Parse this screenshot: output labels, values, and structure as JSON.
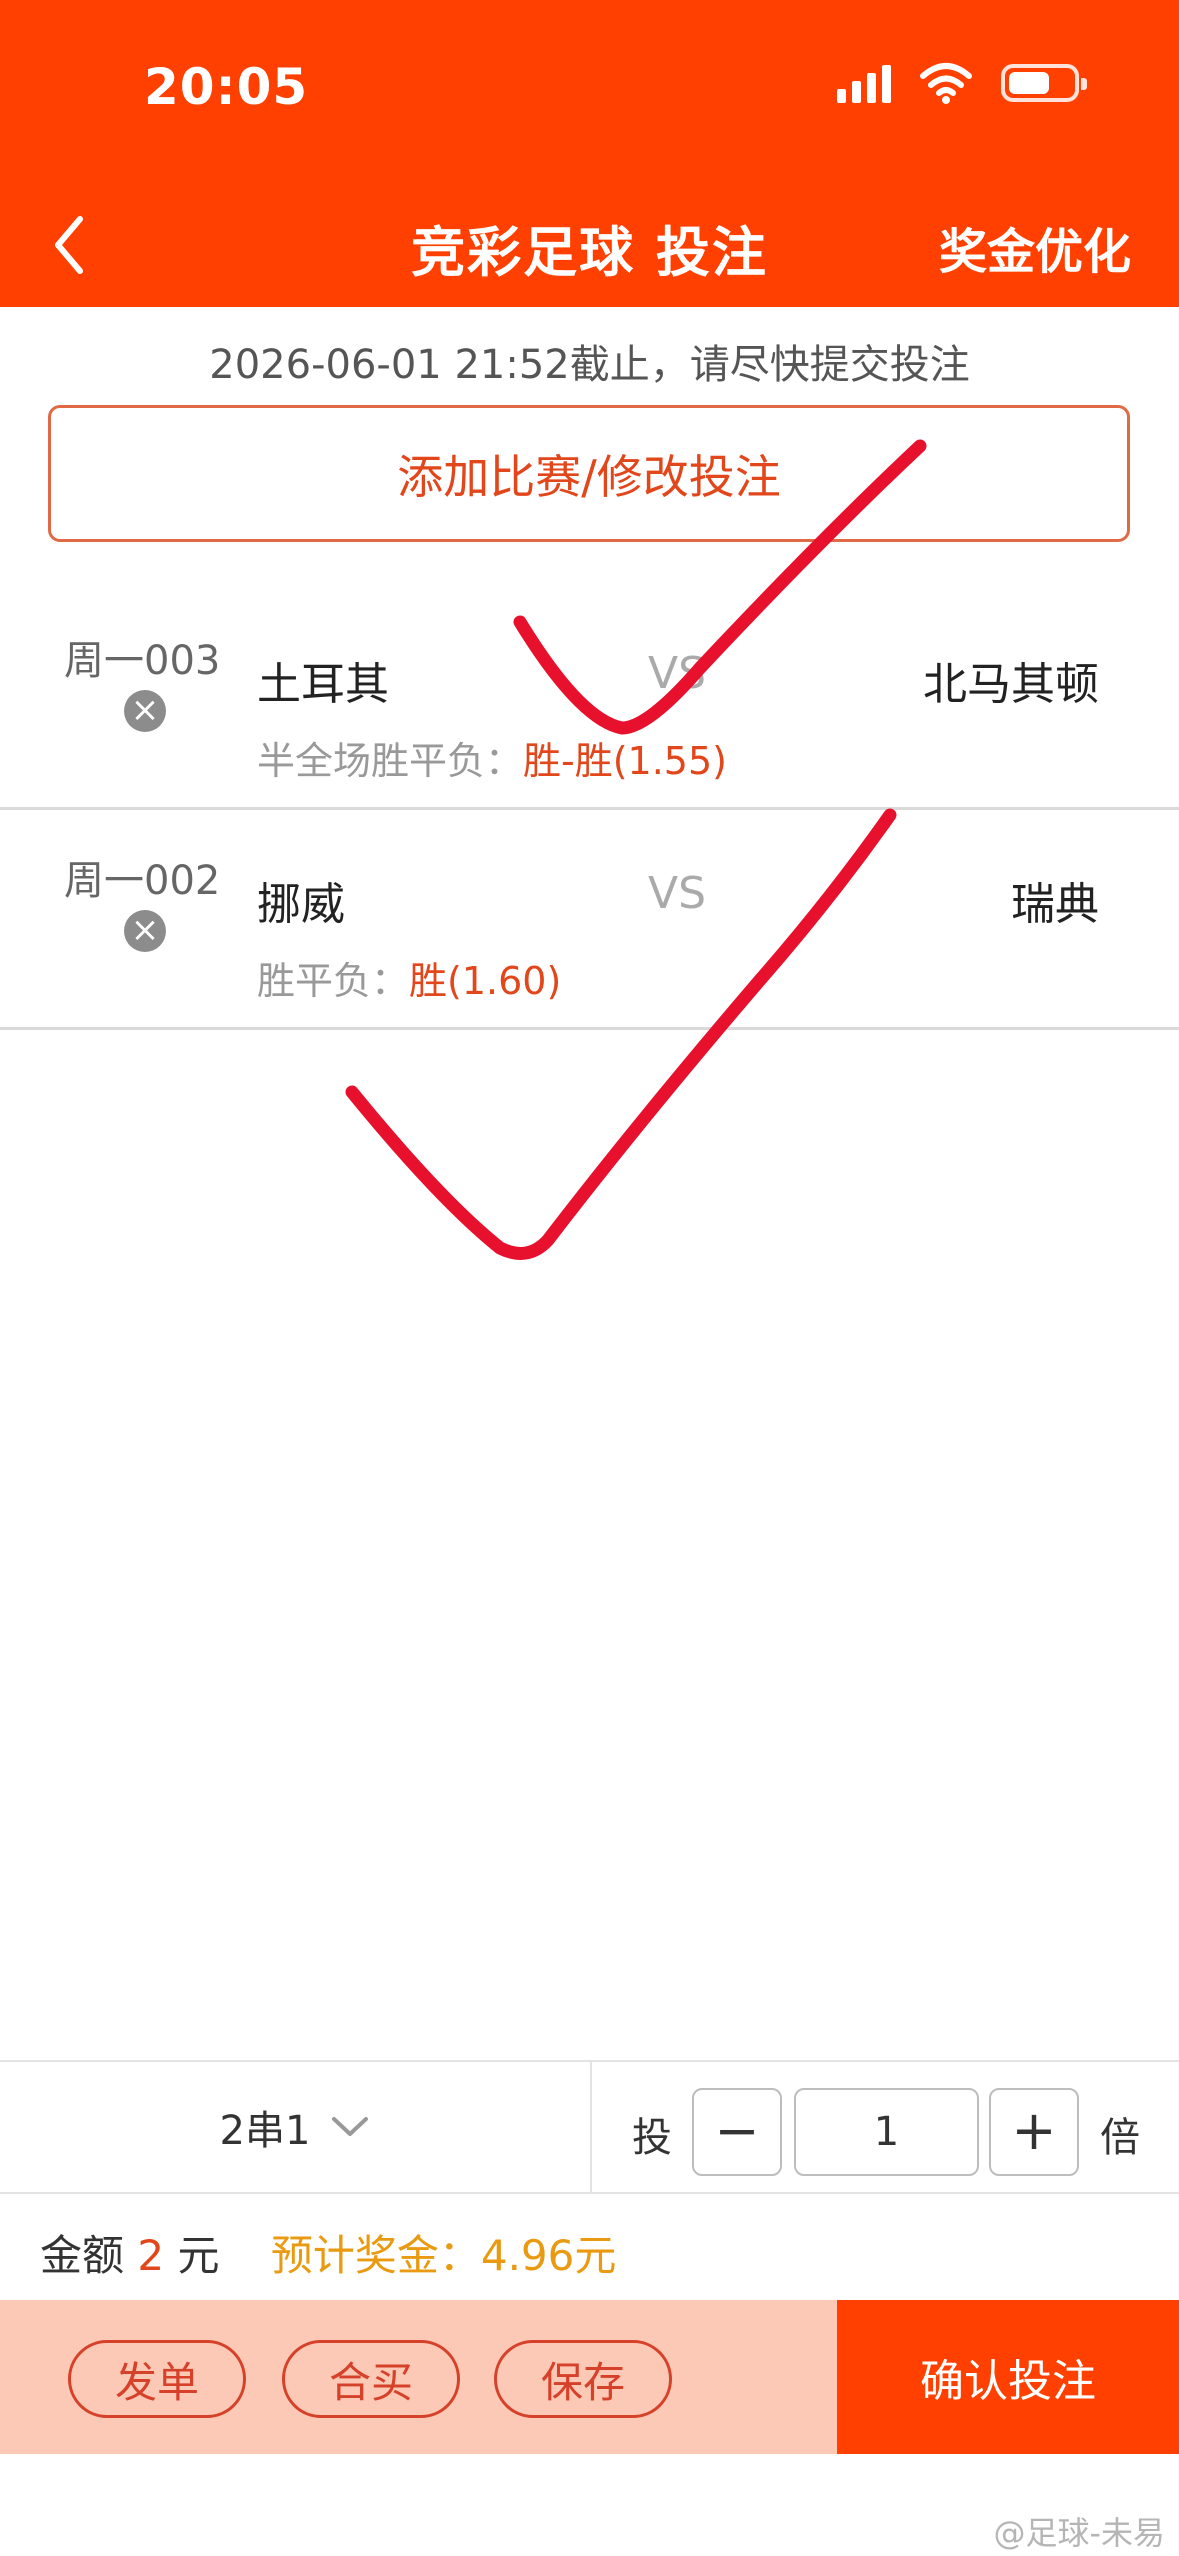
{
  "status_bar": {
    "time": "20:05"
  },
  "nav": {
    "title": "竞彩足球 投注",
    "right_action": "奖金优化"
  },
  "deadline_notice": "2026-06-01 21:52截止，请尽快提交投注",
  "add_button_label": "添加比赛/修改投注",
  "matches": [
    {
      "code": "周一003",
      "home": "土耳其",
      "vs": "VS",
      "away": "北马其顿",
      "play_label": "半全场胜平负：",
      "play_value": "胜-胜(1.55)"
    },
    {
      "code": "周一002",
      "home": "挪威",
      "vs": "VS",
      "away": "瑞典",
      "play_label": "胜平负：",
      "play_value": "胜(1.60)"
    }
  ],
  "bet": {
    "combo": "2串1",
    "multiplier_prefix": "投",
    "minus_label": "−",
    "multiplier_value": "1",
    "plus_label": "+",
    "multiplier_suffix": "倍"
  },
  "amount": {
    "label": "金额",
    "value": "2",
    "unit": "元",
    "prize_text": "预计奖金：4.96元"
  },
  "actions": {
    "post": "发单",
    "group_buy": "合买",
    "save": "保存",
    "confirm": "确认投注"
  },
  "watermark": "@足球-未易",
  "colors": {
    "brand": "#ff4000",
    "accent_text": "#e2461b",
    "prize": "#e99a10",
    "check_mark": "#e8112d",
    "action_bar_bg": "#fdc9b7"
  }
}
